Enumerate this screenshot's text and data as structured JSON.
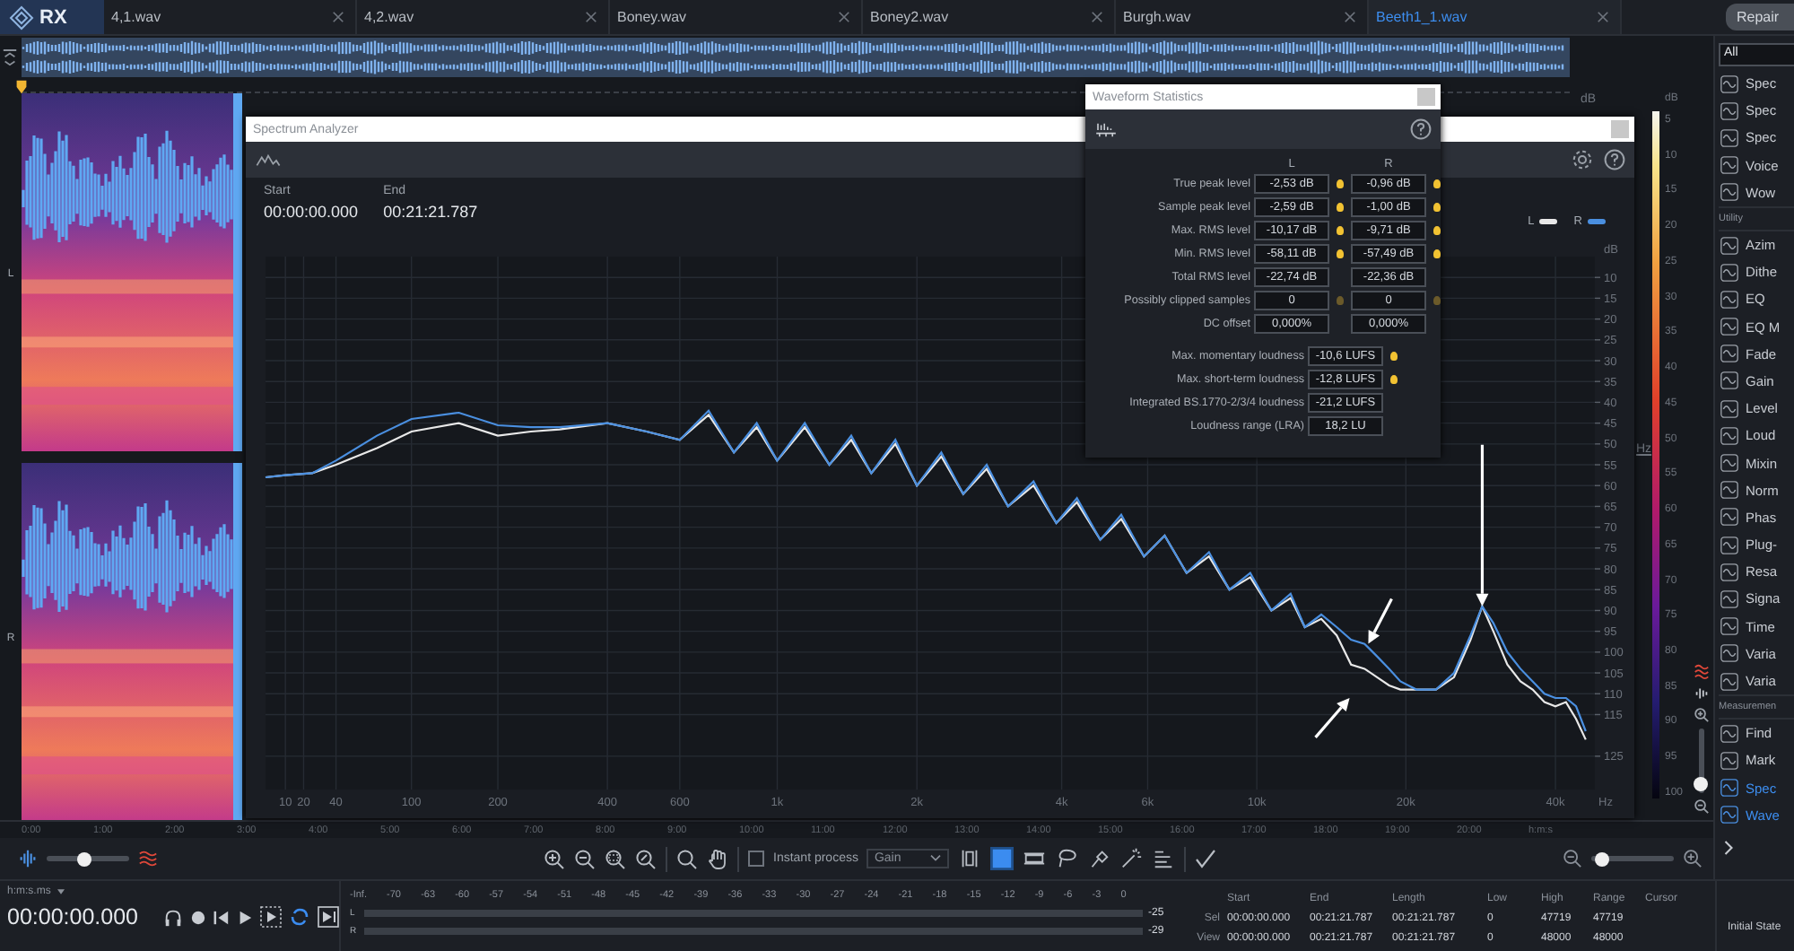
{
  "app": {
    "logo": "RX"
  },
  "tabs": [
    {
      "label": "4,1.wav",
      "selected": false
    },
    {
      "label": "4,2.wav",
      "selected": false
    },
    {
      "label": "Boney.wav",
      "selected": false
    },
    {
      "label": "Boney2.wav",
      "selected": false
    },
    {
      "label": "Burgh.wav",
      "selected": false
    },
    {
      "label": "Beeth1_1.wav",
      "selected": true
    }
  ],
  "repair_button": "Repair",
  "editor": {
    "channels": [
      "L",
      "R"
    ],
    "db_label": "dB",
    "color_scale": {
      "unit": "dB",
      "axis": "Hz",
      "ticks": [
        "5",
        "10",
        "15",
        "20",
        "25",
        "30",
        "35",
        "40",
        "45",
        "50",
        "55",
        "60",
        "65",
        "70",
        "75",
        "80",
        "85",
        "90",
        "95",
        "100"
      ]
    },
    "vertical_zoom": {
      "level": 0.05
    },
    "timeline": [
      "0:00",
      "1:00",
      "2:00",
      "3:00",
      "4:00",
      "5:00",
      "6:00",
      "7:00",
      "8:00",
      "9:00",
      "10:00",
      "11:00",
      "12:00",
      "13:00",
      "14:00",
      "15:00",
      "16:00",
      "17:00",
      "18:00",
      "19:00",
      "20:00"
    ],
    "timeline_unit": "h:m:s"
  },
  "spectrum_analyzer": {
    "title": "Spectrum Analyzer",
    "start_label": "Start",
    "start": "00:00:00.000",
    "end_label": "End",
    "end": "00:21:21.787",
    "plot": {
      "legend": [
        {
          "name": "L",
          "color": "#e8e8e8"
        },
        {
          "name": "R",
          "color": "#4a8fe0"
        }
      ],
      "x_labels": [
        "10",
        "20",
        "40",
        "100",
        "200",
        "400",
        "600",
        "1k",
        "2k",
        "4k",
        "6k",
        "10k",
        "20k",
        "40k"
      ],
      "x_unit": "Hz",
      "y_unit": "dB",
      "y_labels": [
        "10",
        "15",
        "20",
        "25",
        "30",
        "35",
        "40",
        "45",
        "50",
        "55",
        "60",
        "65",
        "70",
        "75",
        "80",
        "85",
        "90",
        "95",
        "100",
        "105",
        "110",
        "115",
        "125"
      ]
    }
  },
  "waveform_statistics": {
    "title": "Waveform Statistics",
    "columns": [
      "L",
      "R"
    ],
    "rows": [
      {
        "label": "True peak level",
        "values": [
          {
            "text": "-2,53 dB",
            "color": "#f2c232"
          },
          {
            "text": "-0,96 dB",
            "color": "#f2c232"
          }
        ]
      },
      {
        "label": "Sample peak level",
        "values": [
          {
            "text": "-2,59 dB",
            "color": "#f2c232"
          },
          {
            "text": "-1,00 dB",
            "color": "#f2c232"
          }
        ]
      },
      {
        "label": "Max. RMS level",
        "values": [
          {
            "text": "-10,17 dB",
            "color": "#f2c232"
          },
          {
            "text": "-9,71 dB",
            "color": "#f2c232"
          }
        ]
      },
      {
        "label": "Min. RMS level",
        "values": [
          {
            "text": "-58,11 dB",
            "color": "#f2c232"
          },
          {
            "text": "-57,49 dB",
            "color": "#f2c232"
          }
        ]
      },
      {
        "label": "Total RMS level",
        "values": [
          {
            "text": "-22,74 dB"
          },
          {
            "text": "-22,36 dB"
          }
        ]
      },
      {
        "label": "Possibly clipped samples",
        "values": [
          {
            "text": "0",
            "color": "#6b5a2a"
          },
          {
            "text": "0",
            "color": "#6b5a2a"
          }
        ]
      },
      {
        "label": "DC offset",
        "values": [
          {
            "text": "0,000%"
          },
          {
            "text": "0,000%"
          }
        ]
      }
    ],
    "loudness": [
      {
        "label": "Max. momentary loudness",
        "value": {
          "text": "-10,6 LUFS",
          "color": "#f2c232"
        }
      },
      {
        "label": "Max. short-term loudness",
        "value": {
          "text": "-12,8 LUFS",
          "color": "#f2c232"
        }
      },
      {
        "label": "Integrated BS.1770-2/3/4 loudness",
        "value": {
          "text": "-21,2 LUFS"
        }
      },
      {
        "label": "Loudness range (LRA)",
        "value": {
          "text": "18,2 LU"
        }
      }
    ]
  },
  "modules": {
    "filter": "All",
    "items": [
      {
        "kind": "item",
        "label": "Spec",
        "active": false
      },
      {
        "kind": "item",
        "label": "Spec",
        "active": false
      },
      {
        "kind": "item",
        "label": "Spec",
        "active": false
      },
      {
        "kind": "item",
        "label": "Voice",
        "active": false
      },
      {
        "kind": "item",
        "label": "Wow",
        "active": false
      },
      {
        "kind": "header",
        "label": "Utility"
      },
      {
        "kind": "item",
        "label": "Azim",
        "active": false
      },
      {
        "kind": "item",
        "label": "Dithe",
        "active": false
      },
      {
        "kind": "item",
        "label": "EQ",
        "active": false
      },
      {
        "kind": "item",
        "label": "EQ M",
        "active": false
      },
      {
        "kind": "item",
        "label": "Fade",
        "active": false
      },
      {
        "kind": "item",
        "label": "Gain",
        "active": false
      },
      {
        "kind": "item",
        "label": "Level",
        "active": false
      },
      {
        "kind": "item",
        "label": "Loud",
        "active": false
      },
      {
        "kind": "item",
        "label": "Mixin",
        "active": false
      },
      {
        "kind": "item",
        "label": "Norm",
        "active": false
      },
      {
        "kind": "item",
        "label": "Phas",
        "active": false
      },
      {
        "kind": "item",
        "label": "Plug-",
        "active": false
      },
      {
        "kind": "item",
        "label": "Resa",
        "active": false
      },
      {
        "kind": "item",
        "label": "Signa",
        "active": false
      },
      {
        "kind": "item",
        "label": "Time",
        "active": false
      },
      {
        "kind": "item",
        "label": "Varia",
        "active": false
      },
      {
        "kind": "item",
        "label": "Varia",
        "active": false
      },
      {
        "kind": "header",
        "label": "Measuremen"
      },
      {
        "kind": "item",
        "label": "Find",
        "active": false
      },
      {
        "kind": "item",
        "label": "Mark",
        "active": false
      },
      {
        "kind": "item",
        "label": "Spec",
        "active": true
      },
      {
        "kind": "item",
        "label": "Wave",
        "active": true
      }
    ]
  },
  "toolbar": {
    "blend_slider": {
      "level": 0.43
    },
    "instant_process": {
      "label": "Instant process",
      "checked": false
    },
    "process": "Gain",
    "tools": [
      {
        "kind": "time",
        "selected": false
      },
      {
        "kind": "rect",
        "selected": true
      },
      {
        "kind": "freq",
        "selected": false
      },
      {
        "kind": "lasso",
        "selected": false
      },
      {
        "kind": "brush",
        "selected": false
      },
      {
        "kind": "wand",
        "selected": false
      },
      {
        "kind": "harmonic",
        "selected": false
      }
    ],
    "zoom_slider": {
      "level": 0.05
    }
  },
  "transport": {
    "time_format": "h:m:s.ms",
    "time": "00:00:00.000",
    "loop": true
  },
  "meter": {
    "scale": [
      "-Inf.",
      "-70",
      "-63",
      "-60",
      "-57",
      "-54",
      "-51",
      "-48",
      "-45",
      "-42",
      "-39",
      "-36",
      "-33",
      "-30",
      "-27",
      "-24",
      "-21",
      "-18",
      "-15",
      "-12",
      "-9",
      "-6",
      "-3",
      "0"
    ],
    "channels": [
      {
        "label": "L",
        "reading": "-25"
      },
      {
        "label": "R",
        "reading": "-29"
      }
    ]
  },
  "selection_info": {
    "columns": [
      "Start",
      "End",
      "Length",
      "Low",
      "High",
      "Range",
      "Cursor"
    ],
    "rows": [
      {
        "label": "Sel",
        "values": [
          "00:00:00.000",
          "00:21:21.787",
          "00:21:21.787",
          "0",
          "47719",
          "47719"
        ]
      },
      {
        "label": "View",
        "values": [
          "00:00:00.000",
          "00:21:21.787",
          "00:21:21.787",
          "0",
          "48000",
          "48000"
        ]
      }
    ]
  },
  "history": [
    "Initial State"
  ]
}
